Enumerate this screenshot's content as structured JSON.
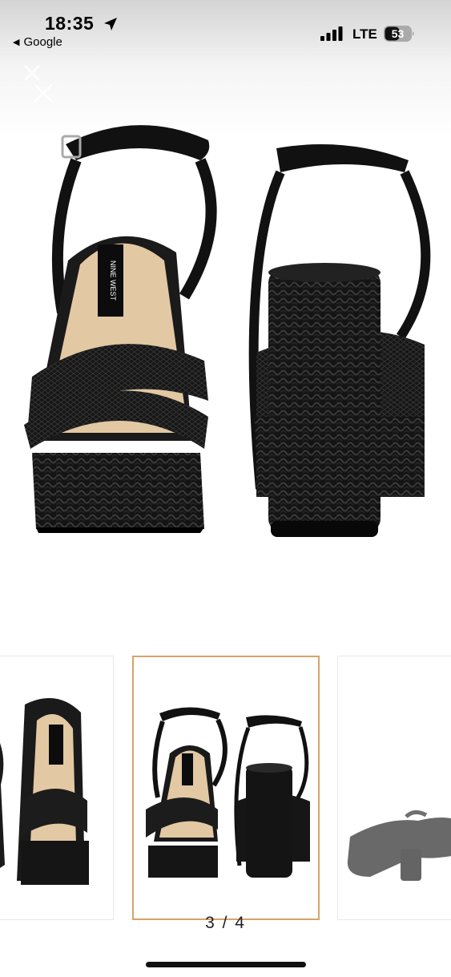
{
  "status_bar": {
    "time": "18:35",
    "back_app": "Google",
    "carrier": "LTE",
    "battery": "53",
    "icons": [
      "location-arrow-icon",
      "cellular-signal-icon",
      "battery-icon"
    ]
  },
  "viewer": {
    "close_icon": "close-icon",
    "brand_label": "NINE WEST",
    "counter": "3 / 4",
    "accent_color": "#d6a36a"
  }
}
